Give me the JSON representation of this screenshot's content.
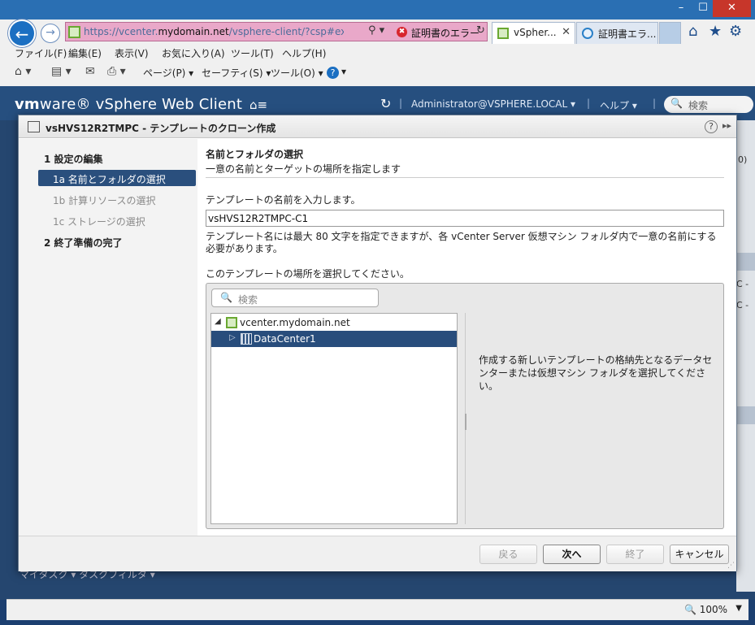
{
  "browser": {
    "window_controls": {
      "minimize": "–",
      "maximize": "☐",
      "close": "✕"
    },
    "address": {
      "url_prefix": "https://vcenter.",
      "url_domain": "mydomain.net",
      "url_suffix": "/vsphere-client/?csp#extens",
      "search_glyph": "⚲ ▾",
      "cert_error": "証明書のエラー",
      "cert_icon": "✖",
      "refresh_glyph": "↻"
    },
    "tabs": [
      {
        "label": "vSpher...",
        "close": "✕"
      },
      {
        "label": "証明書エラ..."
      }
    ],
    "right_icons": {
      "home": "⌂",
      "favorites": "★",
      "tools": "⚙"
    },
    "menu": [
      "ファイル(F)",
      "編集(E)",
      "表示(V)",
      "お気に入り(A)",
      "ツール(T)",
      "ヘルプ(H)"
    ],
    "commands": {
      "home_glyph": "⌂ ▾",
      "feeds_glyph": "▤ ▾",
      "mail_glyph": "✉",
      "print_glyph": "⎙ ▾",
      "page": "ページ(P) ▾",
      "safety": "セーフティ(S) ▾",
      "tools": "ツール(O) ▾",
      "help_glyph": "?",
      "help_dd": "▾"
    },
    "status": {
      "zoom": "🔍 100%",
      "zoom_dd": "▼"
    }
  },
  "vsphere": {
    "logo_vm": "vm",
    "logo_rest": "ware® vSphere Web Client",
    "home_glyph": "⌂≡",
    "refresh_glyph": "↻",
    "sep": "|",
    "user": "Administrator@VSPHERE.LOCAL ▾",
    "help": "ヘルプ ▾",
    "search_glyph": "🔍",
    "search_placeholder": "検索",
    "bg_snippets": [
      "0)",
      "C -",
      "C -"
    ],
    "bg_bottom": "マイタスク ▾     タスクフィルタ ▾"
  },
  "dialog": {
    "title": "vsHVS12R2TMPC - テンプレートのクローン作成",
    "help_glyph": "?",
    "expand_glyph": "▸▸",
    "nav": [
      {
        "label": "1  設定の編集"
      },
      {
        "label": "1a  名前とフォルダの選択"
      },
      {
        "label": "1b  計算リソースの選択"
      },
      {
        "label": "1c  ストレージの選択"
      },
      {
        "label": "2  終了準備の完了"
      }
    ],
    "content": {
      "step_title": "名前とフォルダの選択",
      "step_desc": "一意の名前とターゲットの場所を指定します",
      "name_label": "テンプレートの名前を入力します。",
      "name_value": "vsHVS12R2TMPC-C1",
      "name_note": "テンプレート名には最大 80 文字を指定できますが、各 vCenter Server 仮想マシン フォルダ内で一意の名前にする必要があります。",
      "location_label": "このテンプレートの場所を選択してください。",
      "tree_search_glyph": "🔍",
      "tree_search_placeholder": "検索",
      "tree": {
        "root_twisty": "◢",
        "root_label": "vcenter.mydomain.net",
        "dc_twisty": "▷",
        "dc_label": "DataCenter1"
      },
      "hint": "作成する新しいテンプレートの格納先となるデータセンターまたは仮想マシン フォルダを選択してください。"
    },
    "buttons": {
      "back": "戻る",
      "next": "次へ",
      "finish": "終了",
      "cancel": "キャンセル"
    },
    "resize_grip": "⋰"
  }
}
